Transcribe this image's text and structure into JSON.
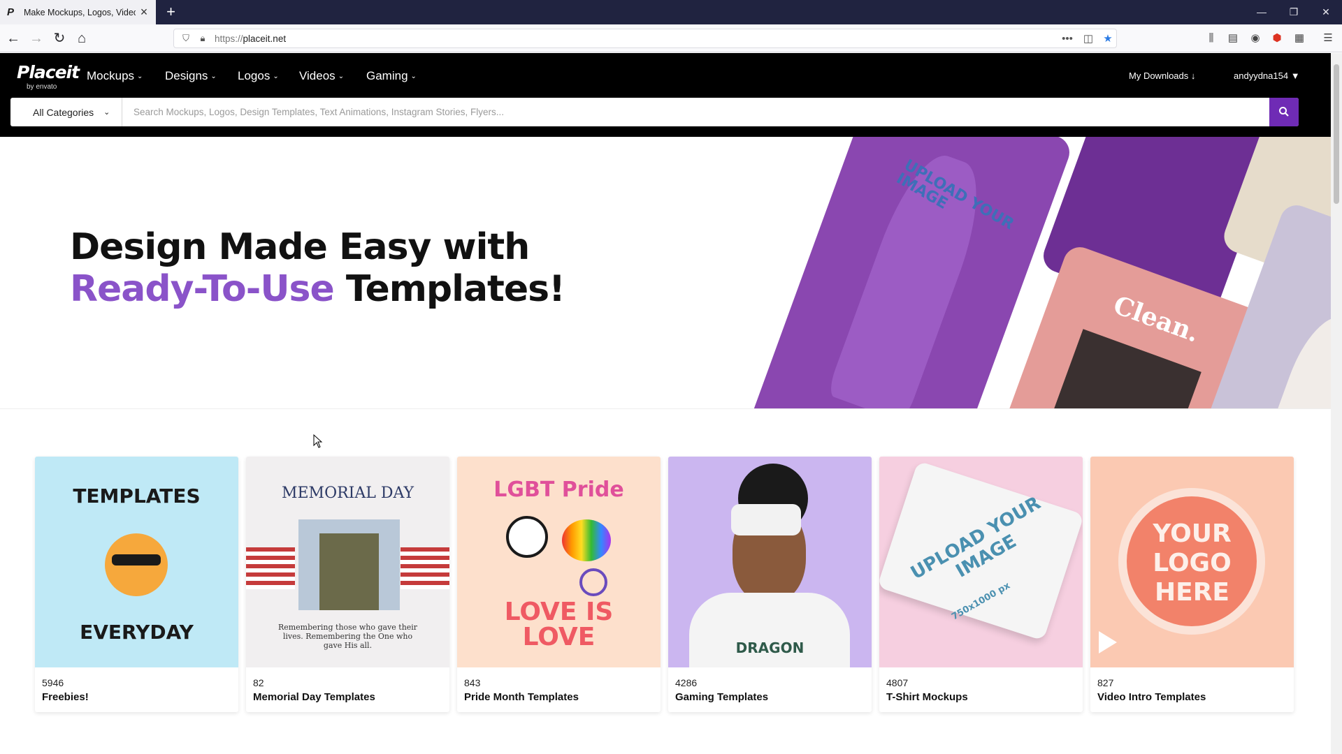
{
  "browser": {
    "tab_favicon": "P",
    "tab_title": "Make Mockups, Logos, Videos",
    "url_protocol": "https://",
    "url_host": "placeit.net"
  },
  "header": {
    "logo_main": "Placeit",
    "logo_sub": "by envato",
    "menu": [
      {
        "label": "Mockups"
      },
      {
        "label": "Designs"
      },
      {
        "label": "Logos"
      },
      {
        "label": "Videos"
      },
      {
        "label": "Gaming"
      }
    ],
    "downloads_label": "My Downloads",
    "username": "andyydna154"
  },
  "search": {
    "category": "All Categories",
    "placeholder": "Search Mockups, Logos, Design Templates, Text Animations, Instagram Stories, Flyers..."
  },
  "hero": {
    "line1": "Design Made Easy with",
    "accent": "Ready-To-Use",
    "line2_rest": "Templates!",
    "collage_text_clean": "Clean.",
    "collage_text_upload": "UPLOAD YOUR IMAGE"
  },
  "categories": [
    {
      "count": "5946",
      "name": "Freebies!",
      "thumb_top": "TEMPLATES",
      "thumb_bottom": "EVERYDAY",
      "bg": "#bfe9f6"
    },
    {
      "count": "82",
      "name": "Memorial Day Templates",
      "thumb_top": "MEMORIAL DAY",
      "thumb_bottom": "Remembering those who gave their lives. Remembering the One who gave His all.",
      "bg": "#f1eff0"
    },
    {
      "count": "843",
      "name": "Pride Month Templates",
      "thumb_top": "LGBT Pride",
      "thumb_bottom": "LOVE IS LOVE",
      "bg": "#fde0cc"
    },
    {
      "count": "4286",
      "name": "Gaming Templates",
      "thumb_top": "",
      "thumb_bottom": "DRAGON",
      "bg": "#cbb6f0"
    },
    {
      "count": "4807",
      "name": "T-Shirt Mockups",
      "thumb_top": "UPLOAD YOUR IMAGE",
      "thumb_bottom": "750x1000 px",
      "bg": "#f6cfe0"
    },
    {
      "count": "827",
      "name": "Video Intro Templates",
      "thumb_top": "YOUR LOGO HERE",
      "thumb_bottom": "",
      "bg": "#fbc9b2"
    }
  ],
  "colors": {
    "accent": "#8a53c9",
    "search_button": "#6f2bb5",
    "header_bg": "#000000"
  }
}
